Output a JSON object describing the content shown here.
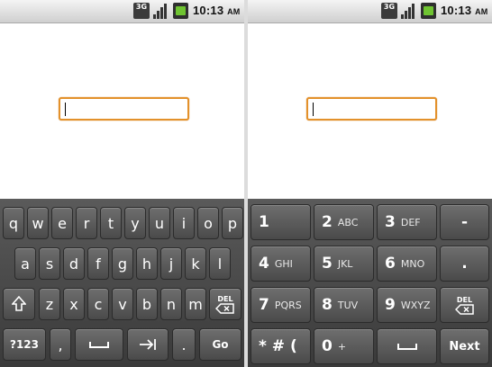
{
  "status_bar": {
    "network": "3G",
    "time": "10:13",
    "ampm": "AM"
  },
  "qwerty": {
    "row1": [
      "q",
      "w",
      "e",
      "r",
      "t",
      "y",
      "u",
      "i",
      "o",
      "p"
    ],
    "row2": [
      "a",
      "s",
      "d",
      "f",
      "g",
      "h",
      "j",
      "k",
      "l"
    ],
    "row3": [
      "z",
      "x",
      "c",
      "v",
      "b",
      "n",
      "m"
    ],
    "del_label": "DEL",
    "sym_label": "?123",
    "comma": ",",
    "period": ".",
    "go_label": "Go"
  },
  "phonepad": {
    "keys": [
      {
        "num": "1",
        "sub": ""
      },
      {
        "num": "2",
        "sub": "ABC"
      },
      {
        "num": "3",
        "sub": "DEF"
      },
      {
        "num": "-",
        "sub": ""
      },
      {
        "num": "4",
        "sub": "GHI"
      },
      {
        "num": "5",
        "sub": "JKL"
      },
      {
        "num": "6",
        "sub": "MNO"
      },
      {
        "num": ".",
        "sub": ""
      },
      {
        "num": "7",
        "sub": "PQRS"
      },
      {
        "num": "8",
        "sub": "TUV"
      },
      {
        "num": "9",
        "sub": "WXYZ"
      },
      {
        "num": "DEL",
        "sub": ""
      },
      {
        "num": "* # (",
        "sub": ""
      },
      {
        "num": "0",
        "sub": "+"
      },
      {
        "num": "",
        "sub": ""
      },
      {
        "num": "Next",
        "sub": ""
      }
    ]
  }
}
